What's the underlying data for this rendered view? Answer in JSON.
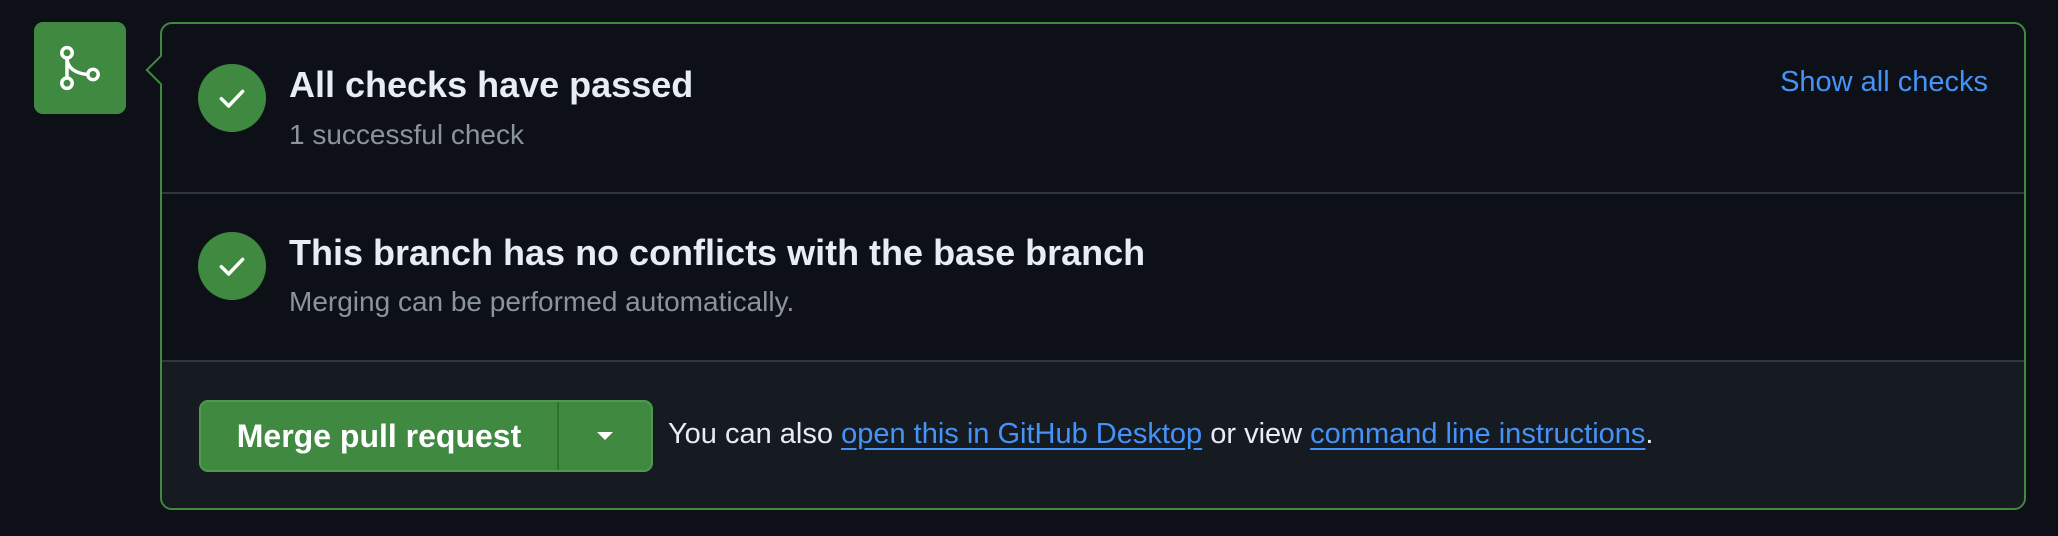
{
  "checks": {
    "title": "All checks have passed",
    "subtitle": "1 successful check",
    "show_all_label": "Show all checks"
  },
  "conflicts": {
    "title": "This branch has no conflicts with the base branch",
    "subtitle": "Merging can be performed automatically."
  },
  "merge": {
    "button_label": "Merge pull request",
    "text_prefix": "You can also",
    "desktop_link": "open this in GitHub Desktop",
    "text_middle": "or view",
    "cli_link": "command line instructions",
    "text_suffix": "."
  },
  "icons": {
    "status": "git-merge-icon",
    "check": "check-icon",
    "dropdown": "triangle-down-icon"
  },
  "colors": {
    "success": "#3f8a40",
    "link": "#4493f8",
    "background": "#0d1117",
    "muted_text": "#8b949e"
  }
}
